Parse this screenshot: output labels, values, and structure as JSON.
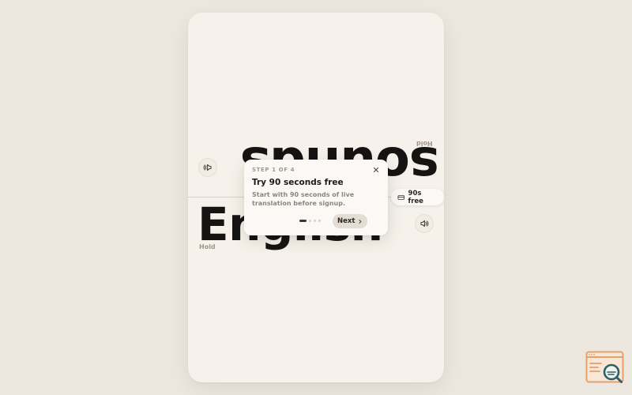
{
  "conversation": {
    "top_word": "sounds",
    "top_hold_label": "Hold",
    "bottom_word": "English",
    "bottom_hold_label": "Hold"
  },
  "badge": {
    "label": "90s free",
    "icon": "ticket-icon"
  },
  "onboarding": {
    "step_label": "STEP 1 OF 4",
    "title": "Try 90 seconds free",
    "body": "Start with 90 seconds of live translation before signup.",
    "next_label": "Next",
    "total_steps": 4,
    "current_step": 1
  },
  "icons": {
    "top_button": "speaker-icon",
    "bottom_button": "speaker-icon",
    "close": "close-icon",
    "next": "chevron-right-icon"
  },
  "colors": {
    "background": "#ece8e0",
    "card": "#f6f2eb",
    "text": "#161412",
    "muted": "#9c968d"
  }
}
